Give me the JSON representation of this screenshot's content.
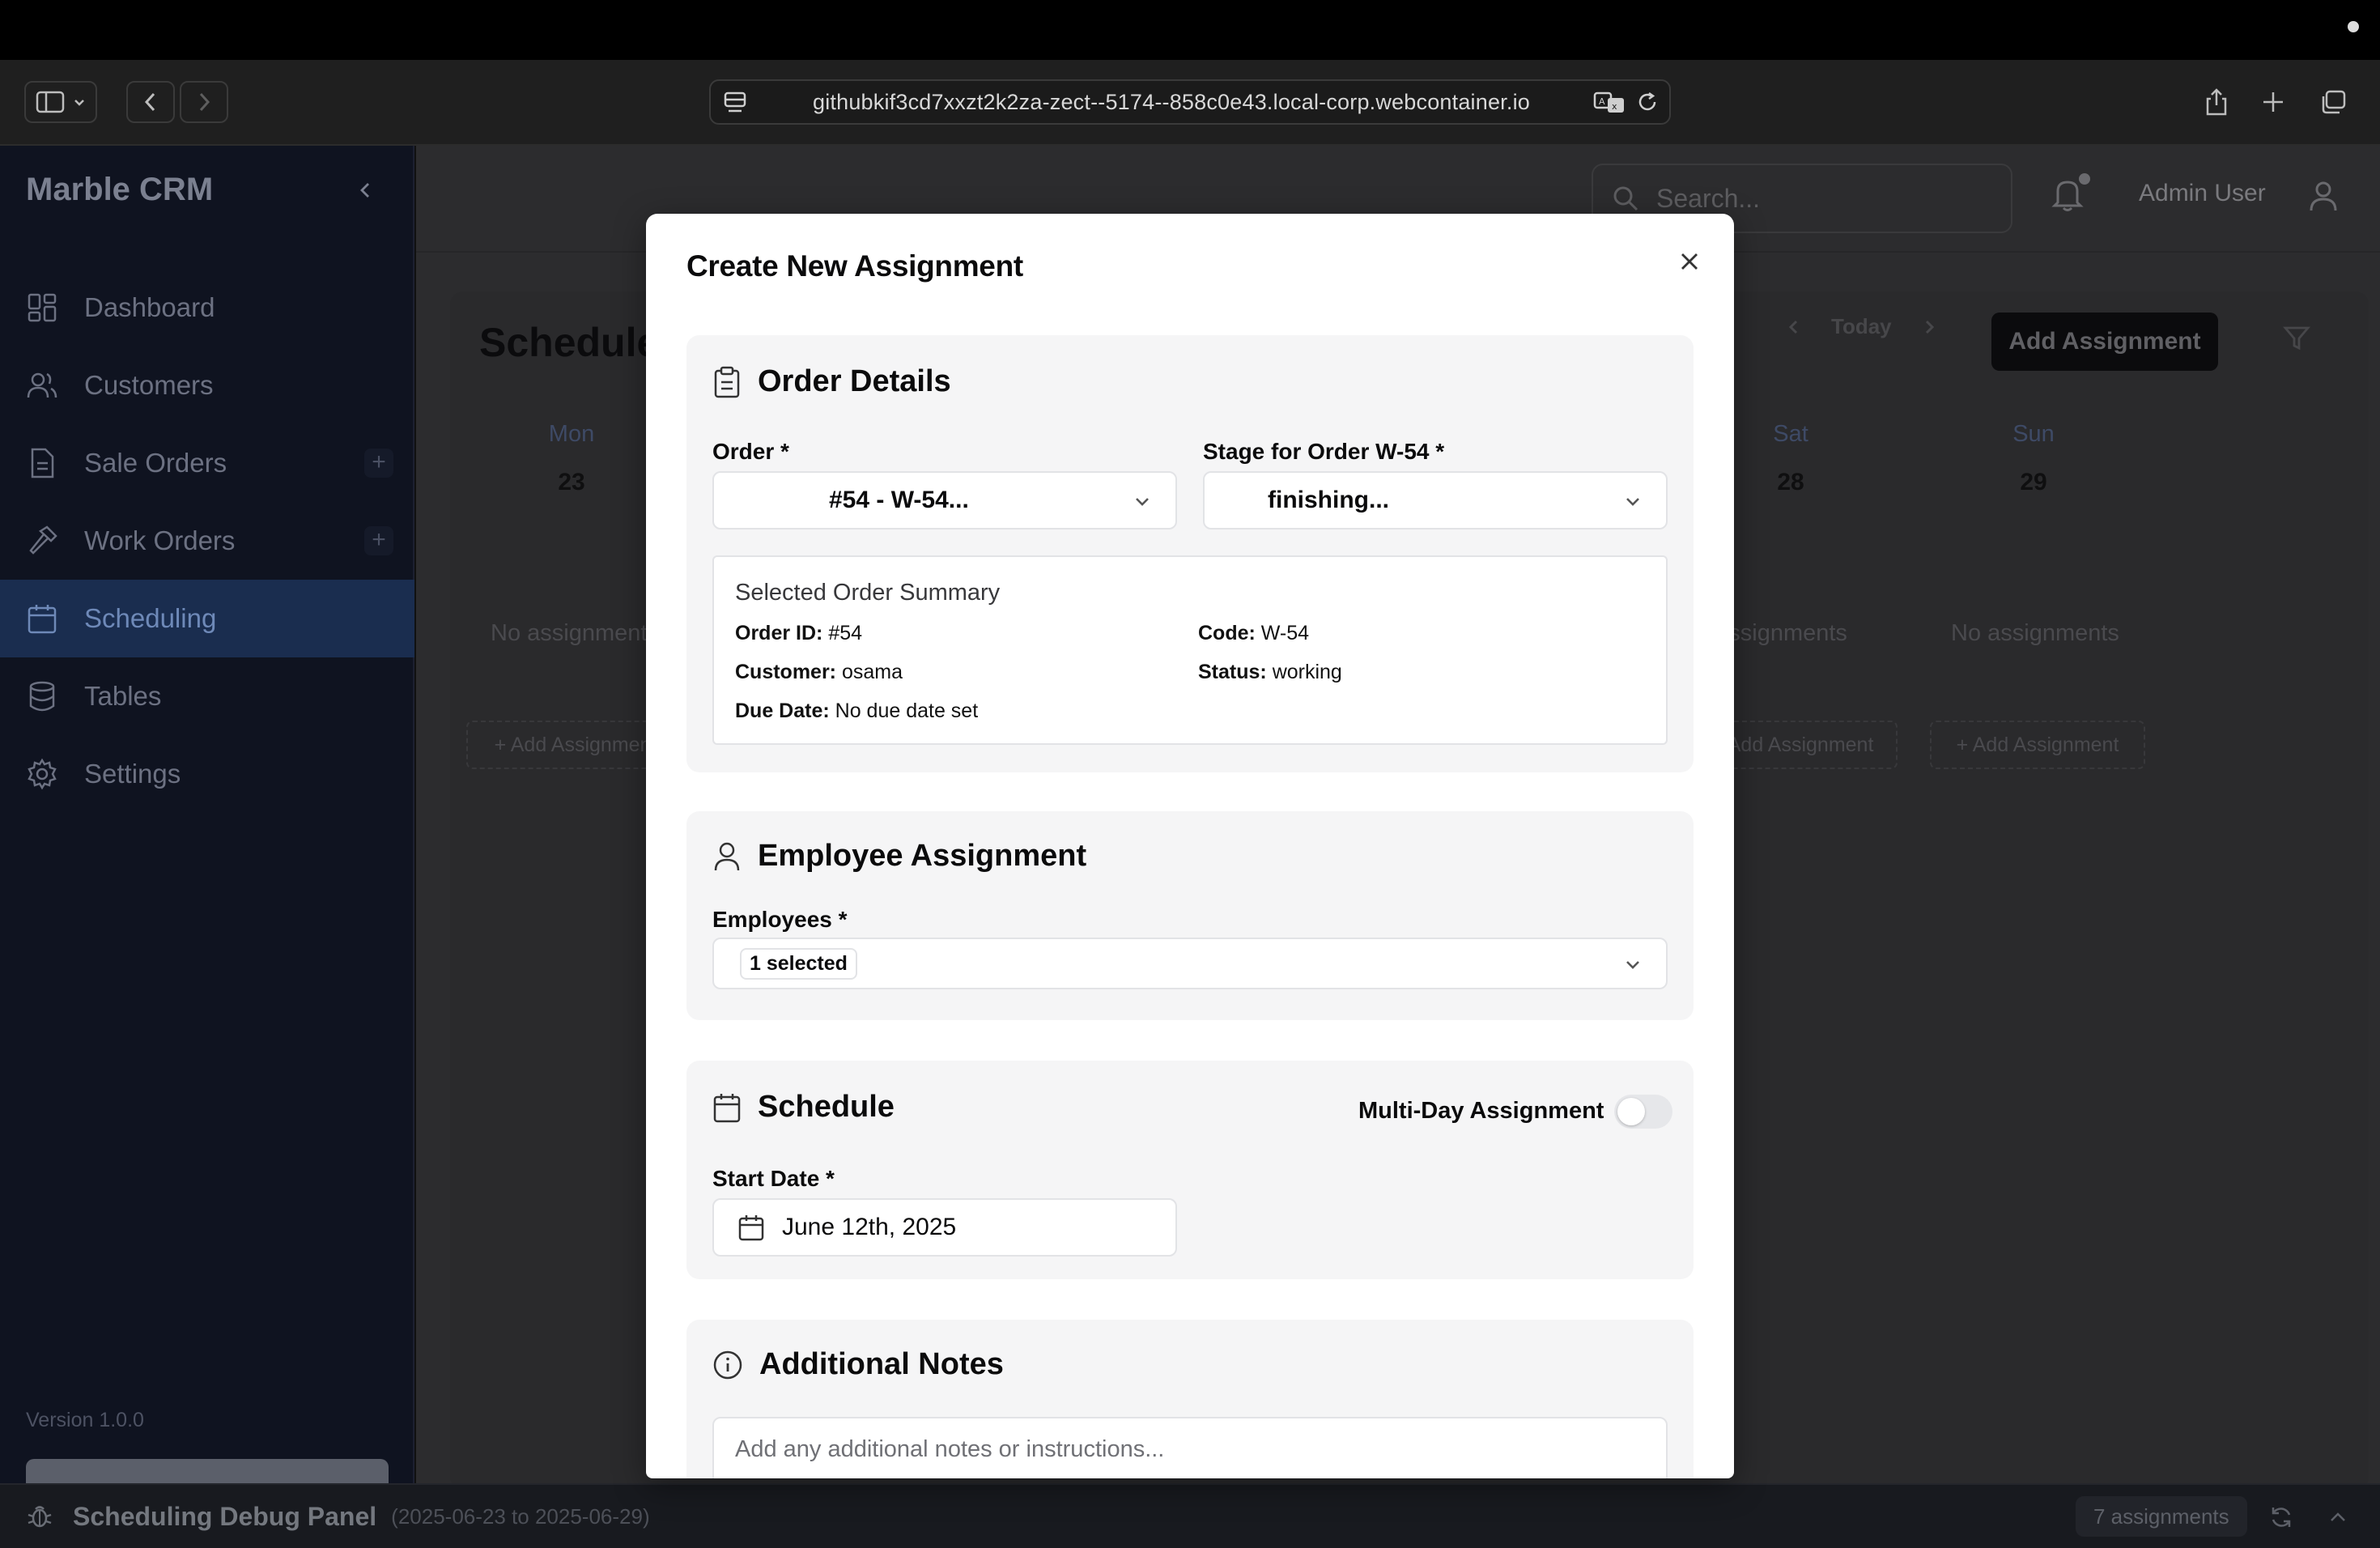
{
  "browser": {
    "url": "githubkif3cd7xxzt2k2za-zect--5174--858c0e43.local-corp.webcontainer.io"
  },
  "sidebar": {
    "brand": "Marble CRM",
    "items": [
      {
        "label": "Dashboard",
        "icon": "dashboard-icon"
      },
      {
        "label": "Customers",
        "icon": "users-icon"
      },
      {
        "label": "Sale Orders",
        "icon": "document-icon"
      },
      {
        "label": "Work Orders",
        "icon": "hammer-icon"
      },
      {
        "label": "Scheduling",
        "icon": "calendar-icon"
      },
      {
        "label": "Tables",
        "icon": "database-icon"
      },
      {
        "label": "Settings",
        "icon": "gear-icon"
      }
    ],
    "plus": "+",
    "version": "Version 1.0.0"
  },
  "header": {
    "search_placeholder": "Search...",
    "user": "Admin User"
  },
  "schedule": {
    "title": "Schedule",
    "today": "Today",
    "add_button": "Add Assignment",
    "days": [
      {
        "name": "Mon",
        "date": "23"
      },
      {
        "name": "Sat",
        "date": "28"
      },
      {
        "name": "Sun",
        "date": "29"
      }
    ],
    "no_assignments": "No assignments",
    "add_assignment": "+ Add Assignment"
  },
  "modal": {
    "title": "Create New Assignment",
    "order_details": {
      "heading": "Order Details",
      "order_label": "Order *",
      "order_value": "#54 - W-54...",
      "stage_label": "Stage for Order W-54 *",
      "stage_value": "finishing...",
      "summary": {
        "title": "Selected Order Summary",
        "order_id_label": "Order ID:",
        "order_id": "#54",
        "code_label": "Code:",
        "code": "W-54",
        "customer_label": "Customer:",
        "customer": "osama",
        "status_label": "Status:",
        "status": "working",
        "due_label": "Due Date:",
        "due": "No due date set"
      }
    },
    "employee": {
      "heading": "Employee Assignment",
      "label": "Employees *",
      "value": "1 selected"
    },
    "schedule": {
      "heading": "Schedule",
      "multi_day_label": "Multi-Day Assignment",
      "multi_day": false,
      "start_label": "Start Date *",
      "start_value": "June 12th, 2025"
    },
    "notes": {
      "heading": "Additional Notes",
      "placeholder": "Add any additional notes or instructions..."
    }
  },
  "debug": {
    "title": "Scheduling Debug Panel",
    "range": "(2025-06-23 to 2025-06-29)",
    "count": "7 assignments"
  }
}
